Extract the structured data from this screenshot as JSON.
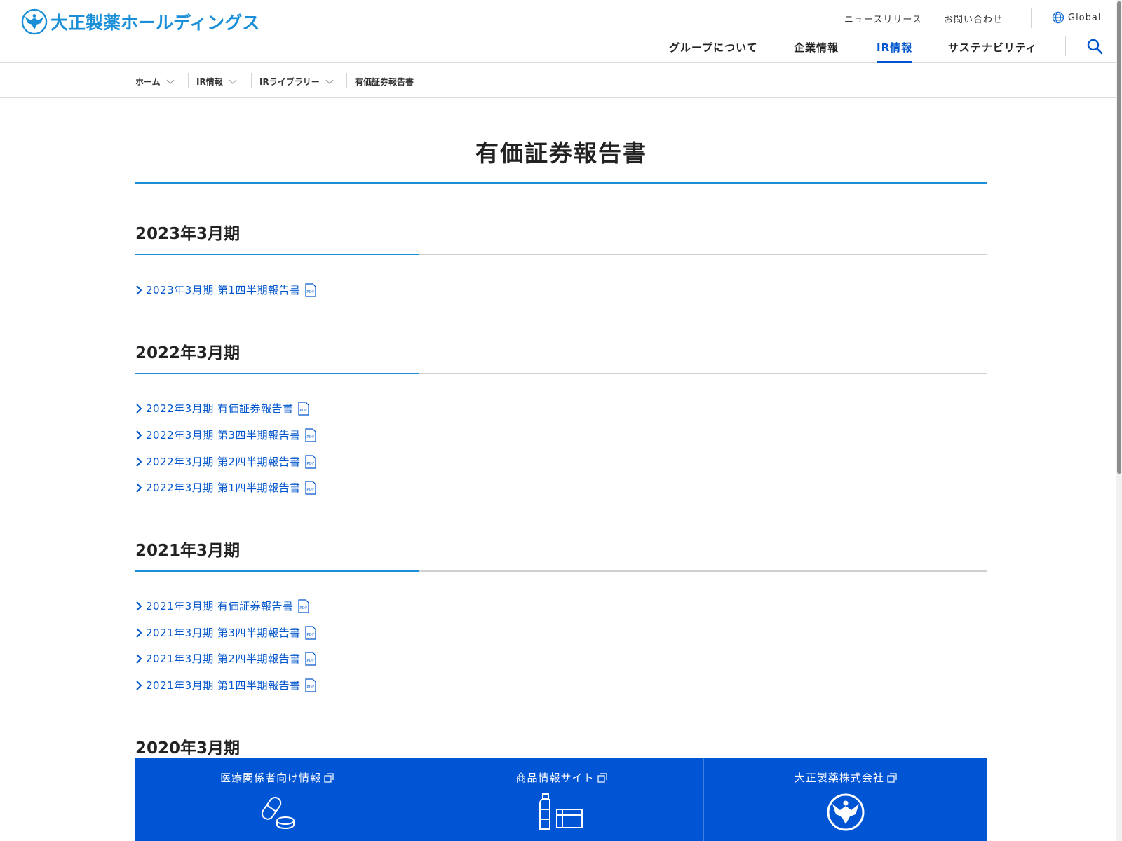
{
  "header": {
    "logo_text": "大正製薬ホールディングス",
    "util_links": {
      "news": "ニュースリリース",
      "contact": "お問い合わせ",
      "global": "Global"
    },
    "nav": {
      "group": "グループについて",
      "corporate": "企業情報",
      "ir": "IR情報",
      "sustainability": "サステナビリティ"
    }
  },
  "breadcrumb": {
    "home": "ホーム",
    "ir": "IR情報",
    "library": "IRライブラリー",
    "current": "有価証券報告書"
  },
  "main": {
    "title": "有価証券報告書",
    "sections": [
      {
        "heading": "2023年3月期",
        "links": [
          "2023年3月期 第1四半期報告書"
        ]
      },
      {
        "heading": "2022年3月期",
        "links": [
          "2022年3月期 有価証券報告書",
          "2022年3月期 第3四半期報告書",
          "2022年3月期 第2四半期報告書",
          "2022年3月期 第1四半期報告書"
        ]
      },
      {
        "heading": "2021年3月期",
        "links": [
          "2021年3月期 有価証券報告書",
          "2021年3月期 第3四半期報告書",
          "2021年3月期 第2四半期報告書",
          "2021年3月期 第1四半期報告書"
        ]
      },
      {
        "heading": "2020年3月期",
        "links": []
      }
    ]
  },
  "banners": [
    {
      "label": "医療関係者向け情報",
      "icon": "pill-icon"
    },
    {
      "label": "商品情報サイト",
      "icon": "products-icon"
    },
    {
      "label": "大正製薬株式会社",
      "icon": "eagle-emblem-icon"
    }
  ],
  "colors": {
    "accent_blue": "#0055cc",
    "brand_blue": "#1a8fd8",
    "banner_blue": "#0055d4"
  }
}
